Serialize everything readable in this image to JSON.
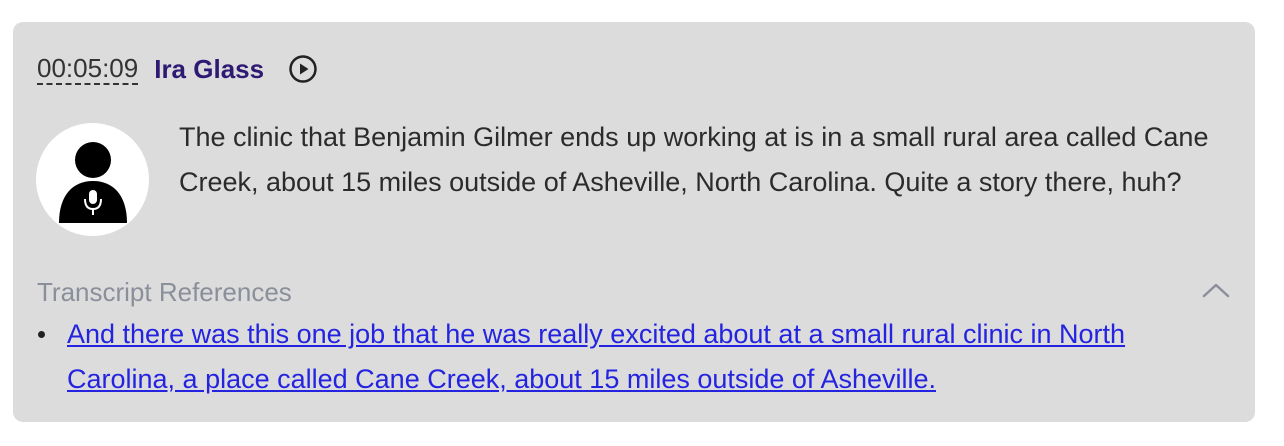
{
  "entry": {
    "timestamp": "00:05:09",
    "speaker": "Ira Glass",
    "play_icon": "play-circle-icon",
    "avatar_icon": "person-with-microphone-icon",
    "text": "The clinic that Benjamin Gilmer ends up working at is in a small rural area called Cane Creek, about 15 miles outside of Asheville, North Carolina. Quite a story there, huh?"
  },
  "references": {
    "title": "Transcript References",
    "collapse_icon": "chevron-up-icon",
    "items": [
      "And there was this one job that he was really excited about at a small rural clinic in North Carolina, a place called Cane Creek, about 15 miles outside of Asheville."
    ]
  },
  "colors": {
    "card_background": "#dcdcdd",
    "speaker": "#2e1a73",
    "link": "#2323e0",
    "muted": "#8a8f9a"
  }
}
